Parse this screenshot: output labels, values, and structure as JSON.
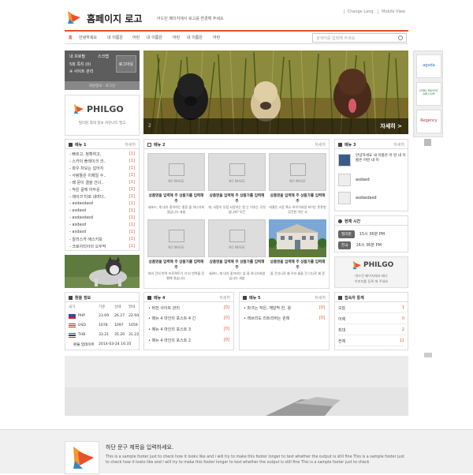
{
  "header": {
    "logo_title": "홈페이지 로고",
    "logo_sub": "어드민 페이지에서 로고를 변경해 주세요",
    "links": [
      "Change Lang",
      "Mobile View"
    ]
  },
  "nav": {
    "home": "홈",
    "items": [
      "안녕하세요",
      "내 이름은",
      "어린",
      "내 이름은",
      "어린",
      "내 이름은",
      "어린"
    ],
    "search_placeholder": "검색어를 입력해 주세요."
  },
  "login": {
    "line1": "내 프로필",
    "line1_right": "스크랩",
    "line2": "5회 쪽지 (0)",
    "line3": "※ 사이트 관리",
    "button": "로그아웃",
    "links": "회원정보 · 로그인"
  },
  "philgo": {
    "brand": "PHILGO",
    "tagline": "필리핀 최대 정보 커뮤니티 필고"
  },
  "hero": {
    "num": "2",
    "more": "자세히 >"
  },
  "ads": [
    {
      "name": "agoda",
      "color": "#2b6fb6"
    },
    {
      "name": "CEBU PACIFIC AIR.COM",
      "color": "#1b7a3a"
    },
    {
      "name": "Regency",
      "color": "#b3364a"
    }
  ],
  "menu1": {
    "title": "메뉴 1",
    "more": "자세히",
    "items": [
      {
        "text": "- 빠르고, 정확하고,",
        "count": "[1]"
      },
      {
        "text": "- 스카이 플레이크 크..",
        "count": "[1]"
      },
      {
        "text": "- 파우 차모는 갔어지",
        "count": "[1]"
      },
      {
        "text": "- 사랑들은 이제일 수..",
        "count": "[1]"
      },
      {
        "text": "- 왜 문이 결을 건너..",
        "count": "[1]"
      },
      {
        "text": "- 작은 굴에 아두운..",
        "count": "[1]"
      },
      {
        "text": "- 레이크 타포 내려다..",
        "count": "[1]"
      },
      {
        "text": "- asdasdasd",
        "count": "[1]"
      },
      {
        "text": "- asdasd",
        "count": "[1]"
      },
      {
        "text": "- asdasdasd",
        "count": "[1]"
      },
      {
        "text": "- asdasd",
        "count": "[1]"
      },
      {
        "text": "- asdasd",
        "count": "[1]"
      },
      {
        "text": "- 알러스카 애스키모",
        "count": "[1]"
      },
      {
        "text": "- 크로아티아의 오두막",
        "count": "[1]"
      }
    ]
  },
  "menu2": {
    "title": "메뉴 2",
    "more": "자세히",
    "noimage": "NO IMAGE",
    "cards": [
      {
        "title": "상품명을 입력해 주 상품가를 입력해 주",
        "sub": "세포드, 게 내가 좋아하는 홍동 을 하나가외였습니다 새샘"
      },
      {
        "title": "상품명을 입력해 주 상품가를 입력해 주",
        "sub": "게, 사람이 무렵 사랑하는 알 는 이유는 무엇입니까? 모든"
      },
      {
        "title": "상품명을 입력해 주 상품가를 입력해 주",
        "sub": "비결은 소망 흑소 하우이처럼 보이는 튼튼한 강건한 작은 사"
      },
      {
        "title": "상품명을 입력해 주 상품가를 입력해 주",
        "sub": "여러 건의 번역 프로젝트가 기 타 번역을 진행해 왔습니다."
      },
      {
        "title": "상품명을 입력해 주 상품가를 입력해 주",
        "sub": "세워드, 게 내가 좋아하는 않 을 하나가외였습니다 새샘"
      },
      {
        "title": "상품명을 입력해 주 상품가를 입력해 주",
        "sub": "좀 건너나로 왜 우리 둘을 건 너나로 왜 문"
      }
    ]
  },
  "menu3": {
    "title": "메뉴 3",
    "more": "자세히",
    "items": [
      "안녕하세요 내 이름은 어 린 내 이름은 어린 내 이",
      "asdasd",
      "asdasdasd"
    ]
  },
  "time": {
    "title": "현재 시간",
    "rows": [
      {
        "label": "필리핀",
        "value": "15시 36분 PM"
      },
      {
        "label": "한국",
        "value": "16시 36분 PM"
      }
    ]
  },
  "philgo2": {
    "brand": "PHILGO",
    "line1": "여드민 페이지에서 배너",
    "line2": "이미지를 등록 해 주세요"
  },
  "currency": {
    "title": "환율 정보",
    "headers": [
      "국가",
      "기준",
      "살때",
      "팔때"
    ],
    "rows": [
      {
        "code": "PHP",
        "base": "23.69",
        "buy": "26.27",
        "sell": "22.94"
      },
      {
        "code": "USD",
        "base": "1078",
        "buy": "1097",
        "sell": "1059"
      },
      {
        "code": "THB",
        "base": "33.21",
        "buy": "35.20",
        "sell": "31.22"
      }
    ],
    "updated_label": "환율 업데이트",
    "updated": "2014-03-24 16:35"
  },
  "menu4": {
    "title": "메뉴 4",
    "more": "자세히",
    "items": [
      {
        "text": "• 버전 사이트 관리",
        "count": "[0]"
      },
      {
        "text": "• 메뉴 4 마인의 포스트 4 긴",
        "count": "[0]"
      },
      {
        "text": "• 메뉴 4 마인의 포스트 3",
        "count": "[0]"
      },
      {
        "text": "• 메뉴 4 마인의 포스트 2",
        "count": "[0]"
      }
    ]
  },
  "menu5": {
    "title": "메뉴 5",
    "more": "자세히",
    "items": [
      {
        "text": "• 파크는 작은, 깨달막 한, 왕",
        "count": "[0]"
      },
      {
        "text": "• 레브리도 리트리버는 원래",
        "count": "[0]"
      }
    ]
  },
  "visits": {
    "title": "접속자 통계",
    "rows": [
      {
        "label": "오늘",
        "value": "1"
      },
      {
        "label": "어제",
        "value": "0"
      },
      {
        "label": "최대",
        "value": "2"
      },
      {
        "label": "전체",
        "value": "11"
      }
    ]
  },
  "footer": {
    "title": "하단 문구 제목을 입력하세요.",
    "text": "This is a sample footer just to check how it looks like and i will try to make this footer longer to test whether the output is still fine This is a sample footer just to check how it looks like and i will try to make this footer longer to test whether the output is still fine This is a sample footer just to check"
  },
  "colors": {
    "accent": "#e8512d",
    "dark": "#5d5d5d"
  }
}
